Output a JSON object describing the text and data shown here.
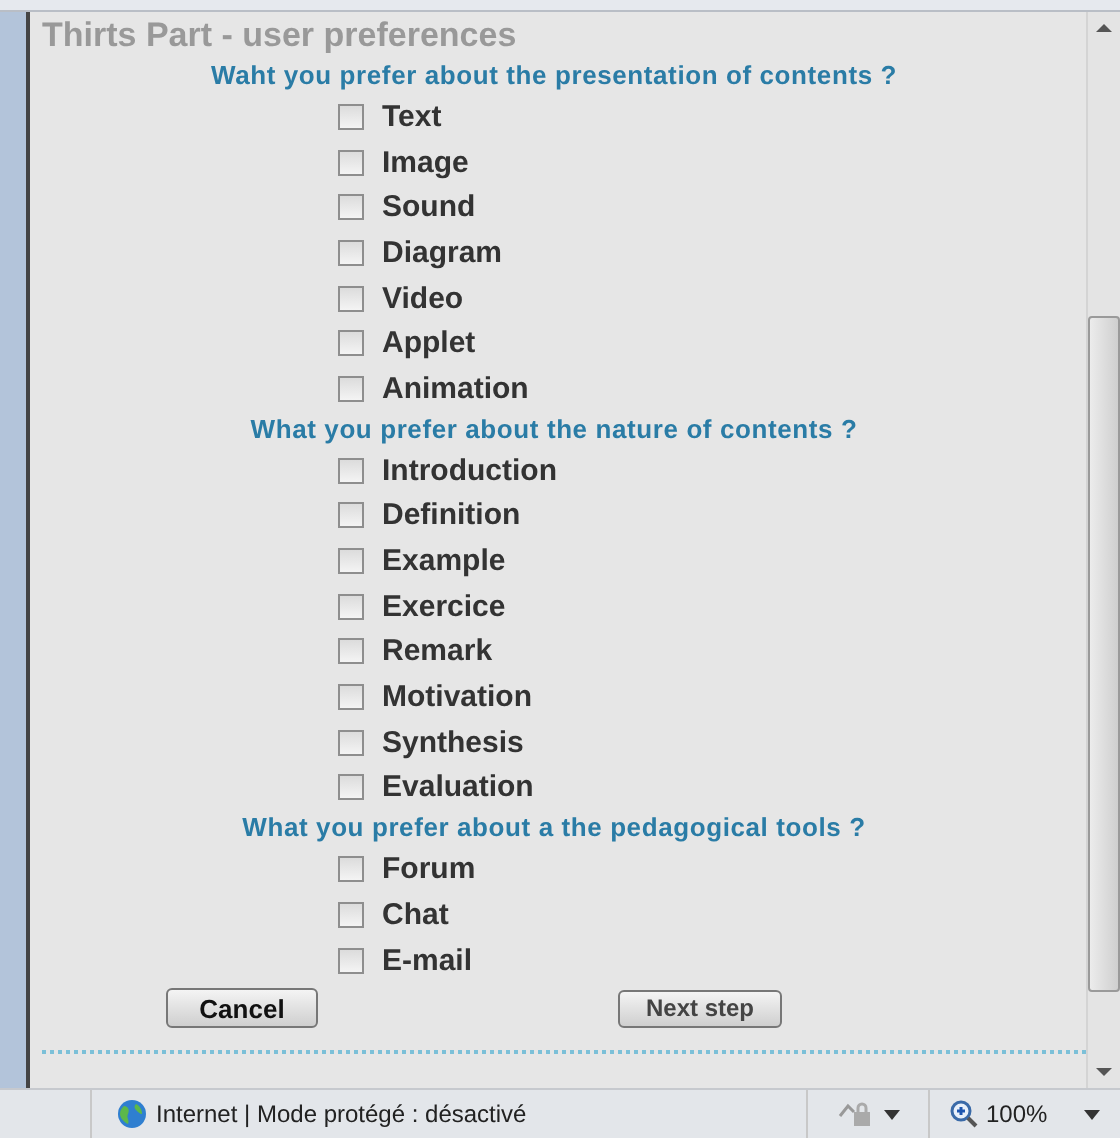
{
  "page": {
    "title": "Thirts Part - user preferences"
  },
  "sections": [
    {
      "question": "Waht you prefer about the presentation of contents  ?",
      "options": [
        {
          "label": "Text",
          "checked": false
        },
        {
          "label": "Image",
          "checked": false
        },
        {
          "label": "Sound",
          "checked": false
        },
        {
          "label": "Diagram",
          "checked": false
        },
        {
          "label": "Video",
          "checked": false
        },
        {
          "label": "Applet",
          "checked": false
        },
        {
          "label": "Animation",
          "checked": false
        }
      ]
    },
    {
      "question": "What you prefer about the nature of contents  ?",
      "options": [
        {
          "label": "Introduction",
          "checked": false
        },
        {
          "label": "Definition",
          "checked": false
        },
        {
          "label": "Example",
          "checked": false
        },
        {
          "label": "Exercice",
          "checked": false
        },
        {
          "label": "Remark",
          "checked": false
        },
        {
          "label": "Motivation",
          "checked": false
        },
        {
          "label": "Synthesis",
          "checked": false
        },
        {
          "label": "Evaluation",
          "checked": false
        }
      ]
    },
    {
      "question": "What you prefer about a the pedagogical tools  ?",
      "options": [
        {
          "label": "Forum",
          "checked": false
        },
        {
          "label": "Chat",
          "checked": false
        },
        {
          "label": "E-mail",
          "checked": false
        }
      ]
    }
  ],
  "buttons": [
    {
      "label": "Cancel",
      "kind": "primary"
    },
    {
      "label": "Next step",
      "kind": "secondary"
    }
  ],
  "status_bar": {
    "zone": "Internet | Mode protégé : désactivé",
    "zoom": "100%"
  }
}
